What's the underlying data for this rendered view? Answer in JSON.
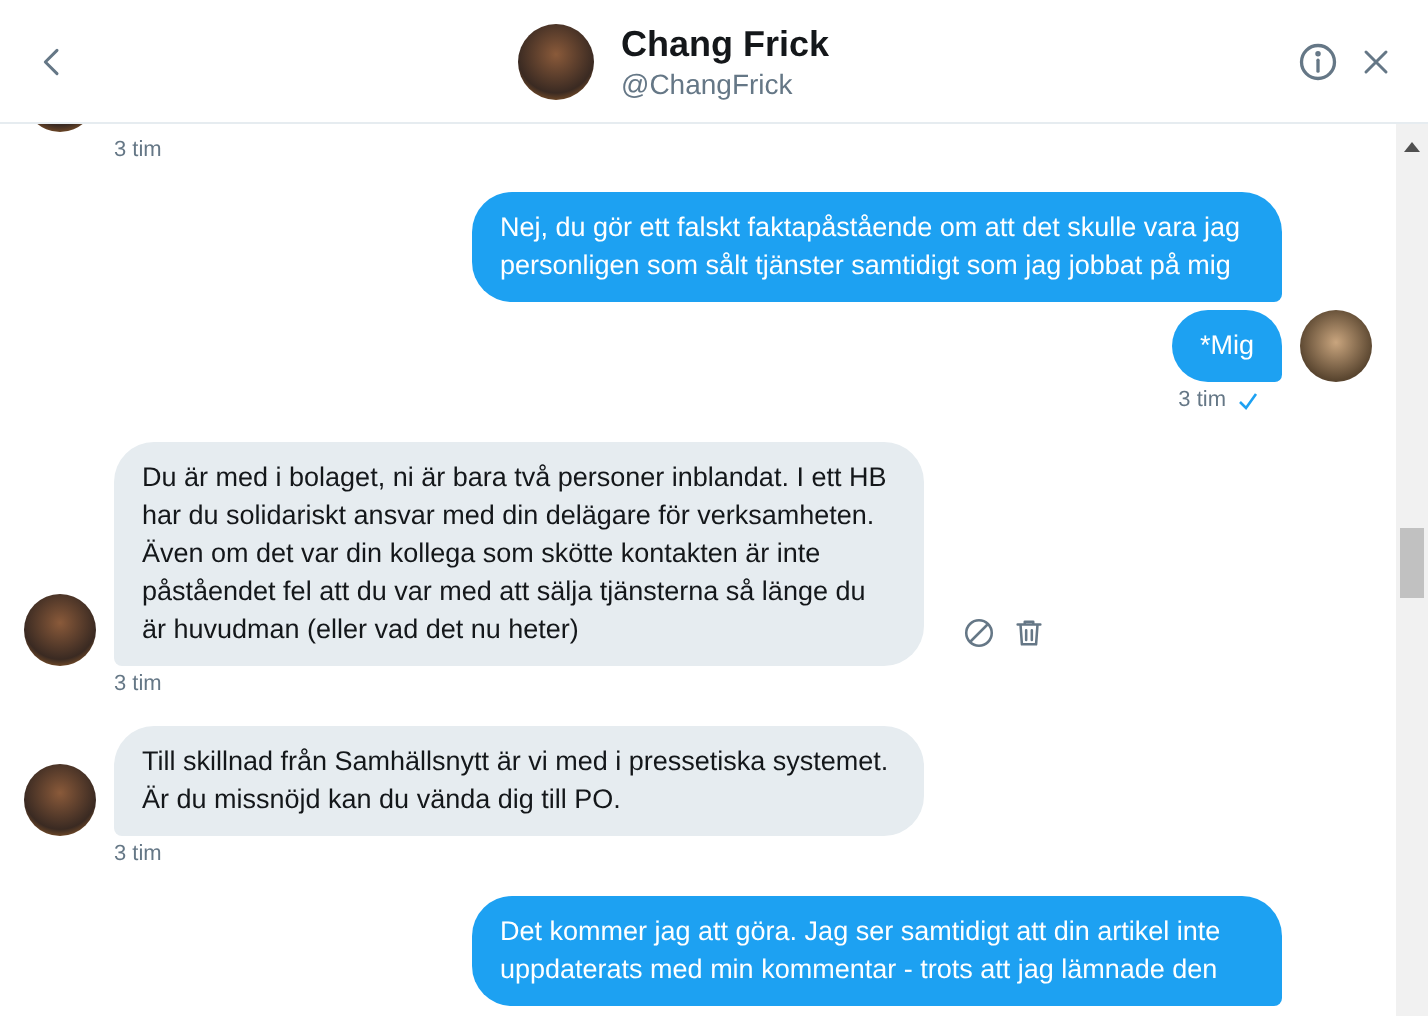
{
  "header": {
    "name": "Chang Frick",
    "handle": "@ChangFrick"
  },
  "messages": [
    {
      "kind": "time_only",
      "time": "3 tim"
    },
    {
      "kind": "sent",
      "text": "Nej, du gör ett falskt faktapåstående om att det skulle vara jag personligen som sålt tjänster samtidigt som jag jobbat på mig"
    },
    {
      "kind": "sent",
      "text": "*Mig",
      "avatar": true,
      "time": "3 tim"
    },
    {
      "kind": "received",
      "text": "Du är med i bolaget, ni är bara två personer inblandat. I ett HB har du solidariskt ansvar med din delägare för verksamheten. Även om det var din kollega som skötte kontakten är inte påståendet fel att du var med att sälja tjänsterna så länge du är huvudman (eller vad det nu heter)",
      "avatar": true,
      "actions": true,
      "time": "3 tim"
    },
    {
      "kind": "received",
      "text": "Till skillnad från Samhällsnytt är vi med i pressetiska systemet. Är du missnöjd kan du vända dig till PO.",
      "avatar": true,
      "time": "3 tim"
    },
    {
      "kind": "sent",
      "text": "Det kommer jag att göra. Jag ser samtidigt att din artikel inte uppdaterats med min kommentar - trots att jag lämnade den"
    }
  ]
}
